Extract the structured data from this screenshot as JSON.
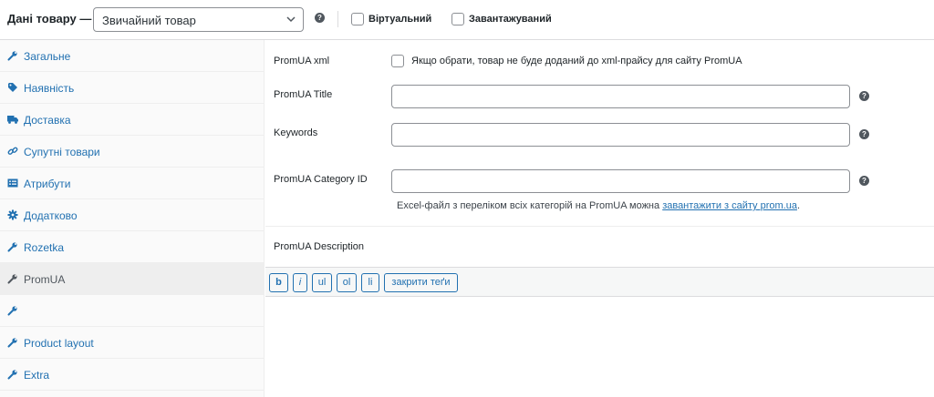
{
  "header": {
    "title": "Дані товару —",
    "product_type": "Звичайний товар",
    "virtual_label": "Віртуальний",
    "downloadable_label": "Завантажуваний",
    "help_glyph": "?"
  },
  "sidebar": {
    "items": [
      {
        "label": "Загальне",
        "icon": "wrench-icon",
        "active": false
      },
      {
        "label": "Наявність",
        "icon": "tag-icon",
        "active": false
      },
      {
        "label": "Доставка",
        "icon": "truck-icon",
        "active": false
      },
      {
        "label": "Супутні товари",
        "icon": "link-icon",
        "active": false
      },
      {
        "label": "Атрибути",
        "icon": "list-icon",
        "active": false
      },
      {
        "label": "Додатково",
        "icon": "gear-icon",
        "active": false
      },
      {
        "label": "Rozetka",
        "icon": "wrench-icon",
        "active": false
      },
      {
        "label": "PromUA",
        "icon": "wrench-icon",
        "active": true
      },
      {
        "label": "",
        "icon": "wrench-icon",
        "active": false
      },
      {
        "label": "Product layout",
        "icon": "wrench-icon",
        "active": false
      },
      {
        "label": "Extra",
        "icon": "wrench-icon",
        "active": false
      }
    ]
  },
  "fields": {
    "xml_label": "PromUA xml",
    "xml_checkbox_text": "Якщо обрати, товар не буде доданий до xml-прайсу для сайту PromUA",
    "title_label": "PromUA Title",
    "title_value": "",
    "keywords_label": "Keywords",
    "keywords_value": "",
    "category_label": "PromUA Category ID",
    "category_value": "",
    "note_text": "Excel-файл з переліком всіх категорій на PromUA можна ",
    "note_link": "завантажити з сайту prom.ua",
    "note_end": ".",
    "description_label": "PromUA Description"
  },
  "toolbar": {
    "buttons": [
      "b",
      "i",
      "ul",
      "ol",
      "li",
      "закрити теґи"
    ]
  },
  "colors": {
    "accent": "#2271b1",
    "active_tab_bg": "#eeeeee",
    "sidebar_bg": "#fafafa"
  }
}
